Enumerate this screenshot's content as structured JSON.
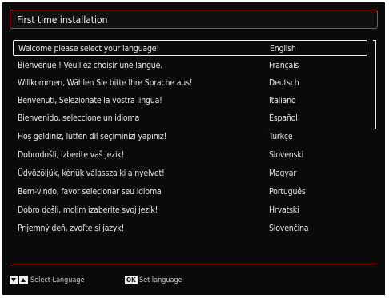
{
  "title": "First time installation",
  "languages": [
    {
      "greeting": "Welcome please select your language!",
      "language": "English"
    },
    {
      "greeting": "Bienvenue ! Veuillez choisir une langue.",
      "language": "Français"
    },
    {
      "greeting": "Willkommen, Wählen Sie bitte Ihre Sprache aus!",
      "language": "Deutsch"
    },
    {
      "greeting": "Benvenuti, Selezionate la vostra lingua!",
      "language": "Italiano"
    },
    {
      "greeting": "Bienvenido, seleccione un idioma",
      "language": "Español"
    },
    {
      "greeting": "Hoş geldiniz, lütfen dil seçiminizi yapınız!",
      "language": "Türkçe"
    },
    {
      "greeting": "Dobrodošli, izberite vaš jezik!",
      "language": "Slovenski"
    },
    {
      "greeting": "Üdvözöljük, kérjük válassza ki a nyelvet!",
      "language": "Magyar"
    },
    {
      "greeting": "Bem-vindo, favor selecionar seu idioma",
      "language": "Português"
    },
    {
      "greeting": "Dobro došli, molim izaberite svoj jezik!",
      "language": "Hrvatski"
    },
    {
      "greeting": "Prijemný deň, zvoľte si jazyk!",
      "language": "Slovenčina"
    }
  ],
  "selected_index": 0,
  "footer": {
    "navigate_icons": [
      "triangle-down-icon",
      "triangle-up-icon"
    ],
    "navigate_label": "Select Language",
    "ok_key": "OK",
    "ok_label": "Set language"
  },
  "colors": {
    "accent": "#c23a3a",
    "background": "#0a0a0a",
    "text": "#e8e8e8",
    "selection_border": "#f0f0f0"
  }
}
